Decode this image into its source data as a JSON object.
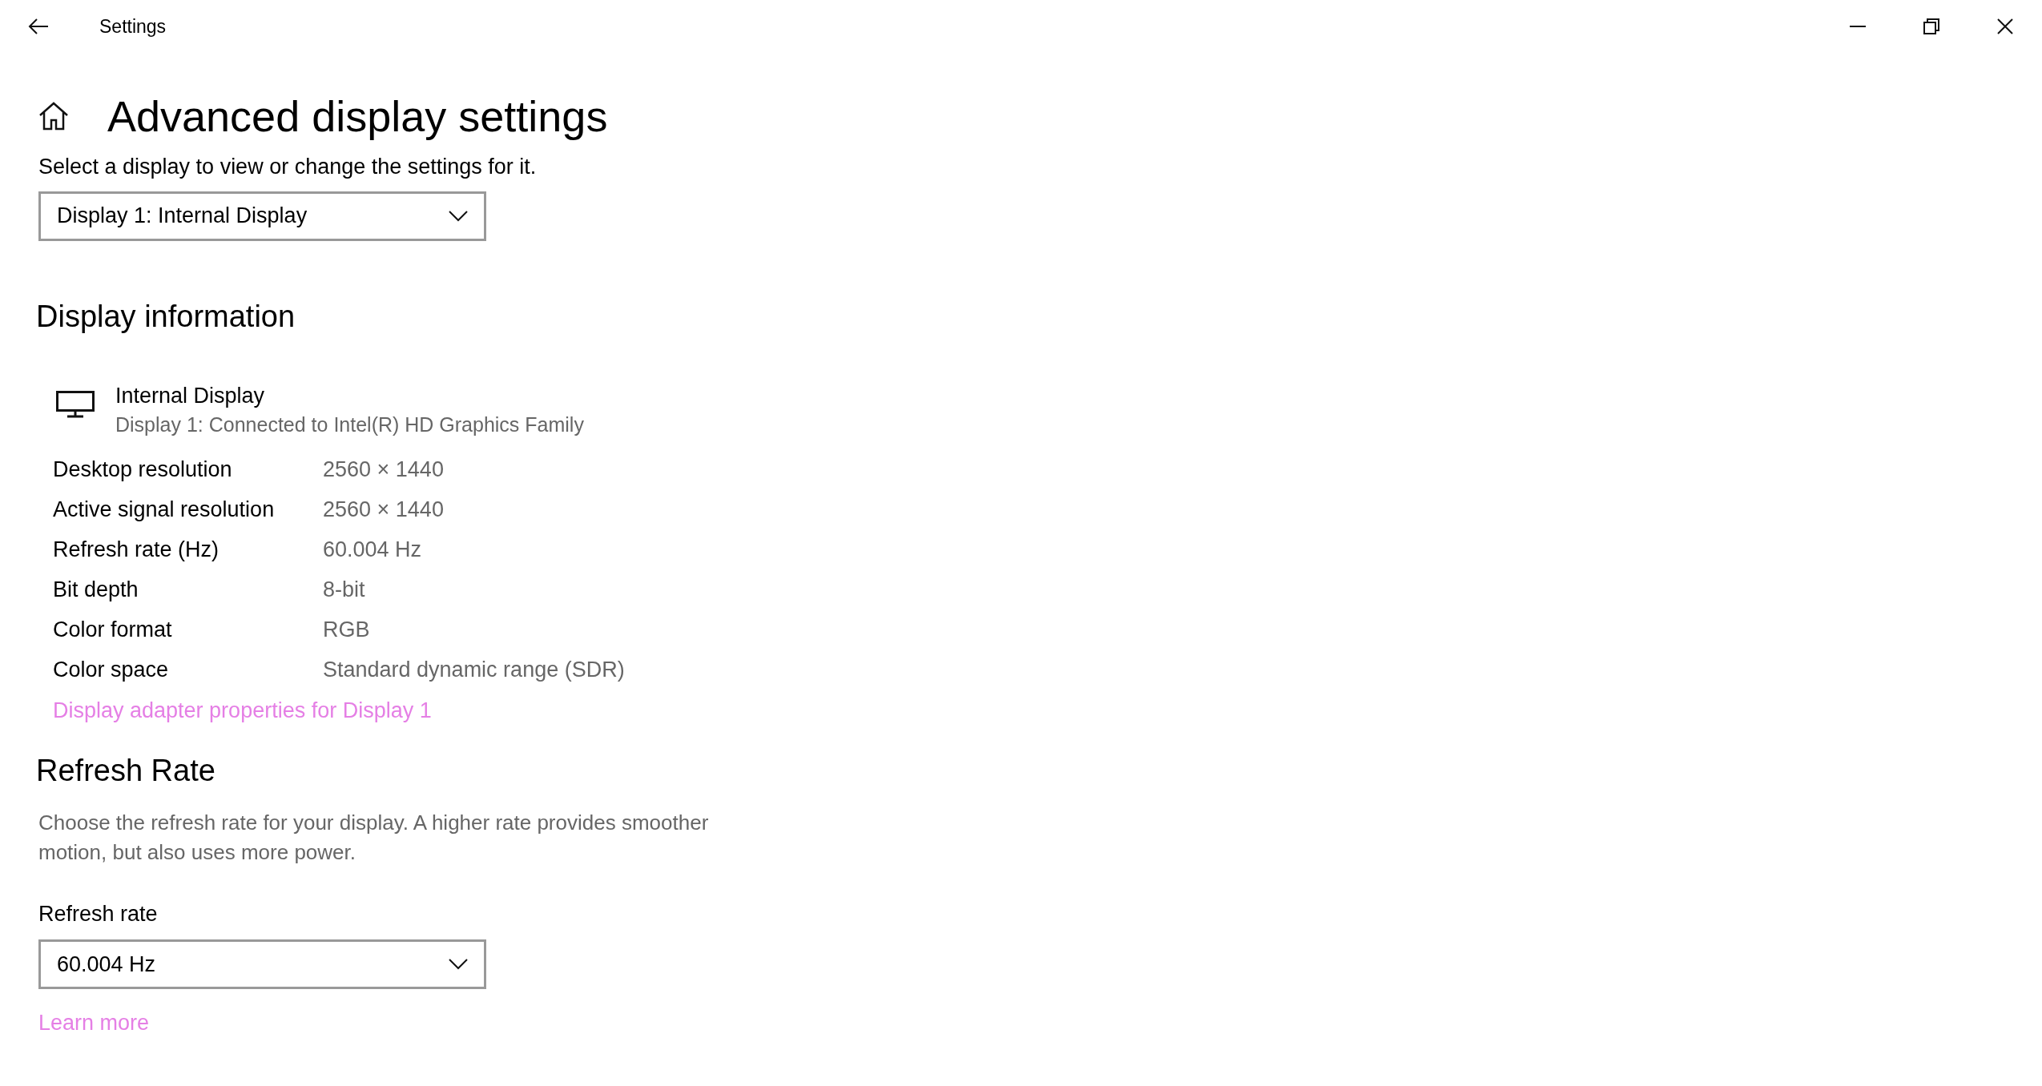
{
  "window": {
    "title": "Settings"
  },
  "page": {
    "title": "Advanced display settings",
    "subtitle": "Select a display to view or change the settings for it."
  },
  "display_select": {
    "value": "Display 1: Internal Display"
  },
  "display_information": {
    "heading": "Display information",
    "display_name": "Internal Display",
    "display_detail": "Display 1: Connected to Intel(R) HD Graphics Family",
    "rows": [
      {
        "label": "Desktop resolution",
        "value": "2560 × 1440"
      },
      {
        "label": "Active signal resolution",
        "value": "2560 × 1440"
      },
      {
        "label": "Refresh rate (Hz)",
        "value": "60.004 Hz"
      },
      {
        "label": "Bit depth",
        "value": "8-bit"
      },
      {
        "label": "Color format",
        "value": "RGB"
      },
      {
        "label": "Color space",
        "value": "Standard dynamic range (SDR)"
      }
    ],
    "link": "Display adapter properties for Display 1"
  },
  "refresh_rate": {
    "heading": "Refresh Rate",
    "description": "Choose the refresh rate for your display. A higher rate provides smoother motion, but also uses more power.",
    "field_label": "Refresh rate",
    "value": "60.004 Hz",
    "link": "Learn more"
  }
}
